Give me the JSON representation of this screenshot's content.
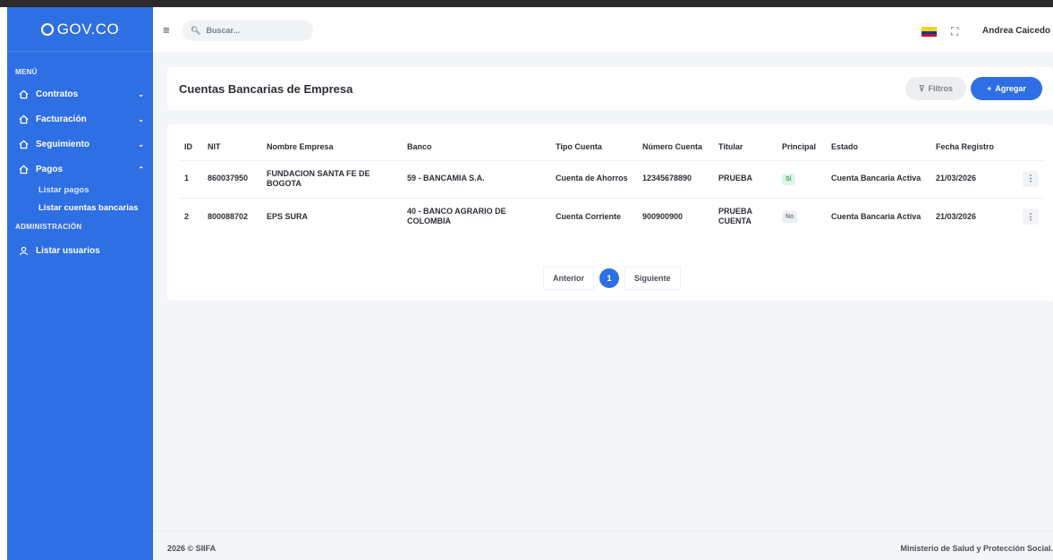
{
  "brand": {
    "logo_text": "GOV.CO"
  },
  "sidebar": {
    "section_menu": "MENÚ",
    "items": [
      {
        "label": "Contratos",
        "chevron": "⌄"
      },
      {
        "label": "Facturación",
        "chevron": "⌄"
      },
      {
        "label": "Seguimiento",
        "chevron": "⌄"
      },
      {
        "label": "Pagos",
        "chevron": "⌃"
      }
    ],
    "pagos_sub": [
      {
        "label": "Listar pagos"
      },
      {
        "label": "Listar cuentas bancarias"
      }
    ],
    "section_admin": "ADMINISTRACIÓN",
    "admin_items": [
      {
        "label": "Listar usuarios"
      }
    ]
  },
  "header": {
    "search_placeholder": "Buscar...",
    "user_name": "Andrea Caicedo",
    "user_chevron": "⌄"
  },
  "page": {
    "title": "Cuentas Bancarias de Empresa",
    "filter_label": "Filtros",
    "add_label": "Agregar"
  },
  "table": {
    "headers": {
      "id": "ID",
      "nit": "NIT",
      "empresa": "Nombre Empresa",
      "banco": "Banco",
      "tipo": "Tipo Cuenta",
      "numero": "Número Cuenta",
      "titular": "Titular",
      "principal": "Principal",
      "estado": "Estado",
      "fecha": "Fecha Registro"
    },
    "rows": [
      {
        "id": "1",
        "nit": "860037950",
        "empresa": "FUNDACION SANTA FE DE BOGOTA",
        "banco": "59 - BANCAMIA S.A.",
        "tipo": "Cuenta de Ahorros",
        "numero": "12345678890",
        "titular": "PRUEBA",
        "principal": "Sí",
        "estado": "Cuenta Bancaria Activa",
        "fecha": "21/03/2026"
      },
      {
        "id": "2",
        "nit": "800088702",
        "empresa": "EPS SURA",
        "banco": "40 - BANCO AGRARIO DE COLOMBIA",
        "tipo": "Cuenta Corriente",
        "numero": "900900900",
        "titular": "PRUEBA CUENTA",
        "principal": "No",
        "estado": "Cuenta Bancaria Activa",
        "fecha": "21/03/2026"
      }
    ]
  },
  "pagination": {
    "prev": "Anterior",
    "current": "1",
    "next": "Siguiente"
  },
  "footer": {
    "left": "2026 © SIIFA",
    "right": "Ministerio de Salud y Protección Social."
  },
  "colors": {
    "primary": "#2f6fe4",
    "badge_si": "#2ea05a",
    "badge_no": "#7d828c"
  }
}
